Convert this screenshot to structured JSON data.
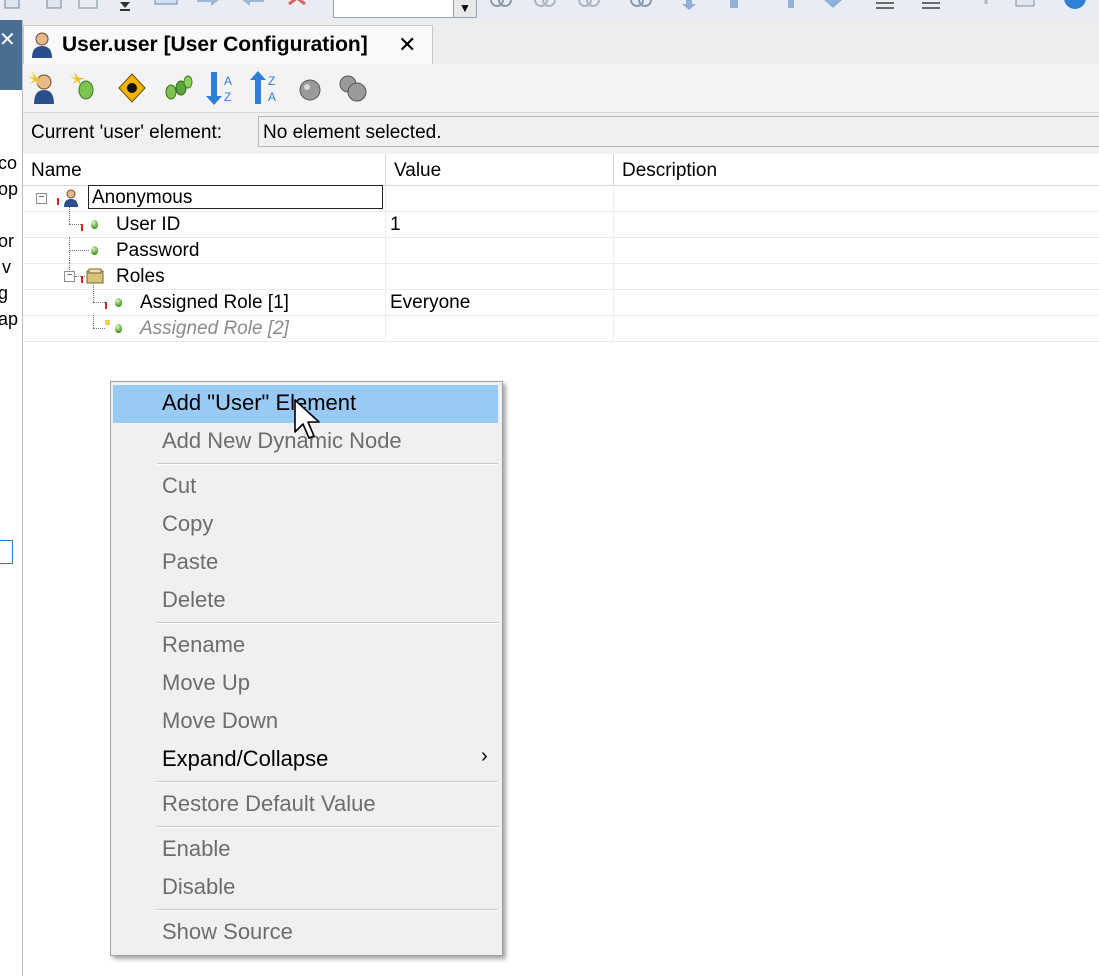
{
  "document_tab": {
    "title": "User.user [User Configuration]",
    "close_glyph": "✕",
    "icon": "user-icon"
  },
  "left_pane": {
    "close_glyph": "✕",
    "fragments": [
      "co",
      "op",
      "or",
      "v",
      "g",
      "ap"
    ]
  },
  "editor_toolbar": {
    "buttons": [
      "add-user-icon",
      "add-node-icon",
      "navigate-icon",
      "expand-all-icon",
      "sort-ascending-icon",
      "sort-descending-icon",
      "circle-icon",
      "circles-icon"
    ]
  },
  "current_element": {
    "label": "Current 'user' element:",
    "value": "No element selected."
  },
  "grid": {
    "columns": [
      "Name",
      "Value",
      "Description"
    ],
    "rows": [
      {
        "name": "Anonymous",
        "value": "",
        "description": ""
      },
      {
        "name": "User ID",
        "value": "1",
        "description": ""
      },
      {
        "name": "Password",
        "value": "",
        "description": ""
      },
      {
        "name": "Roles",
        "value": "",
        "description": ""
      },
      {
        "name": "Assigned Role [1]",
        "value": "Everyone",
        "description": ""
      },
      {
        "name": "Assigned Role [2]",
        "value": "",
        "description": ""
      }
    ]
  },
  "context_menu": {
    "items": [
      {
        "label": "Add \"User\" Element",
        "enabled": true,
        "highlighted": true
      },
      {
        "label": "Add New Dynamic Node",
        "enabled": false
      },
      {
        "label": "Cut",
        "enabled": false
      },
      {
        "label": "Copy",
        "enabled": false
      },
      {
        "label": "Paste",
        "enabled": false
      },
      {
        "label": "Delete",
        "enabled": false
      },
      {
        "label": "Rename",
        "enabled": false
      },
      {
        "label": "Move Up",
        "enabled": false
      },
      {
        "label": "Move Down",
        "enabled": false
      },
      {
        "label": "Expand/Collapse",
        "enabled": true,
        "submenu": true
      },
      {
        "label": "Restore Default Value",
        "enabled": false
      },
      {
        "label": "Enable",
        "enabled": false
      },
      {
        "label": "Disable",
        "enabled": false
      },
      {
        "label": "Show Source",
        "enabled": false
      }
    ],
    "submenu_glyph": "›"
  },
  "colors": {
    "menu_highlight": "#99c9f5",
    "left_pane_header": "#4a6d92",
    "disabled_text": "#6d6d6d"
  }
}
